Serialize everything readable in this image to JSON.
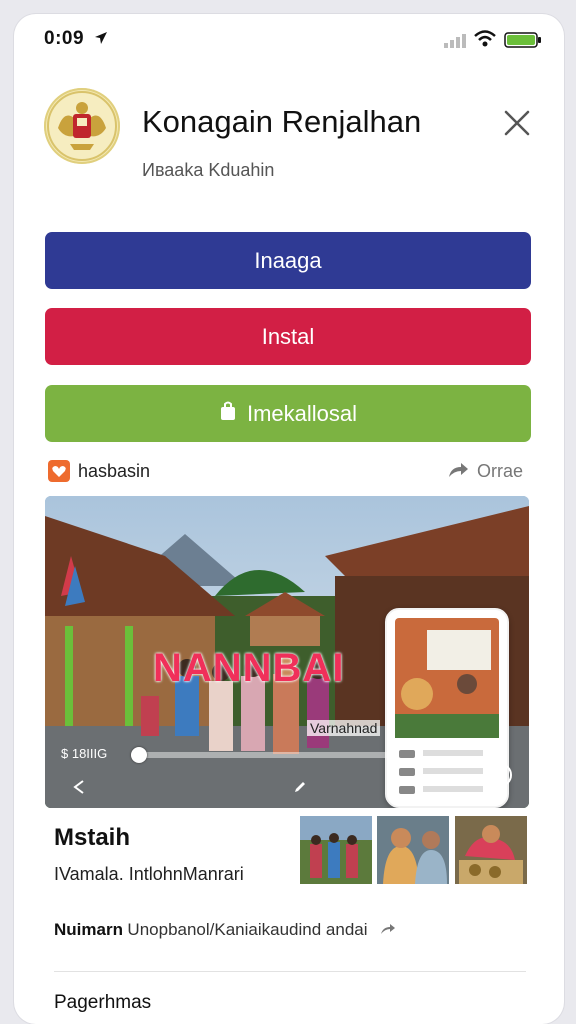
{
  "status_bar": {
    "time": "0:09",
    "icons": [
      "location-arrow-icon",
      "signal-icon",
      "wifi-icon",
      "battery-icon"
    ],
    "battery_color": "#6bbf3a"
  },
  "header": {
    "title": "Konagain Renjalhan",
    "subtitle": "Ивааka Kduahin",
    "emblem_icon": "garuda-emblem-icon",
    "close_icon": "close-icon"
  },
  "actions": {
    "primary_label": "Inaaga",
    "install_label": "Instal",
    "secondary_label": "Imekallosal",
    "colors": {
      "primary": "#2f3a94",
      "install": "#d21f45",
      "secondary": "#7cb342"
    }
  },
  "section": {
    "label": "hasbasin",
    "badge_icon": "heart-badge-icon",
    "share_label": "Orrae",
    "share_icon": "share-arrow-icon"
  },
  "media": {
    "overlay_title": "NANNBAI",
    "caption": "Varnahnad",
    "time": "$ 18IIIG",
    "progress": 0.02,
    "controls": [
      "back-icon",
      "pen-icon",
      "heart-icon"
    ]
  },
  "info": {
    "title": "Mstaih",
    "subtitle": "IVamala. IntlohnManrari",
    "thumbnails": [
      "thumbnail-village-people",
      "thumbnail-women-talking",
      "thumbnail-food-preparation"
    ]
  },
  "detail_row": {
    "label": "Nuimarn",
    "text": "Unopbanol/Kaniaikaudind andai",
    "arrow_icon": "share-arrow-icon"
  },
  "footer": {
    "title": "Pagerhmas"
  }
}
